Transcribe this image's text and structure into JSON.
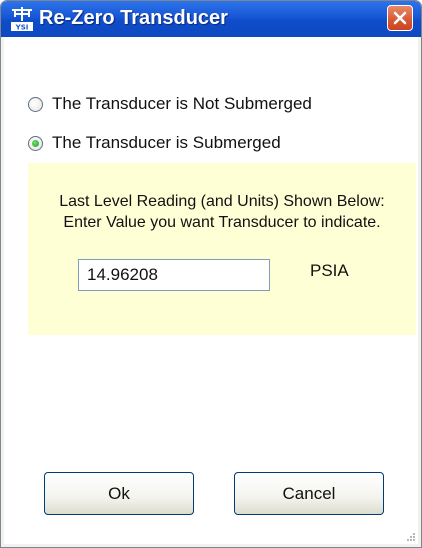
{
  "window": {
    "title": "Re-Zero Transducer",
    "app_icon": "ysi-logo-icon",
    "close_icon": "close-icon"
  },
  "options": [
    {
      "label": "The Transducer is Not Submerged",
      "checked": false
    },
    {
      "label": "The Transducer is Submerged",
      "checked": true
    }
  ],
  "panel": {
    "line1": "Last Level Reading (and Units) Shown Below:",
    "line2": "Enter Value you want Transducer to indicate.",
    "value": "14.96208",
    "units": "PSIA"
  },
  "buttons": {
    "ok": "Ok",
    "cancel": "Cancel"
  },
  "colors": {
    "titlebar": "#1756d6",
    "panel_background": "#ffffd6",
    "close_button": "#d85632"
  }
}
